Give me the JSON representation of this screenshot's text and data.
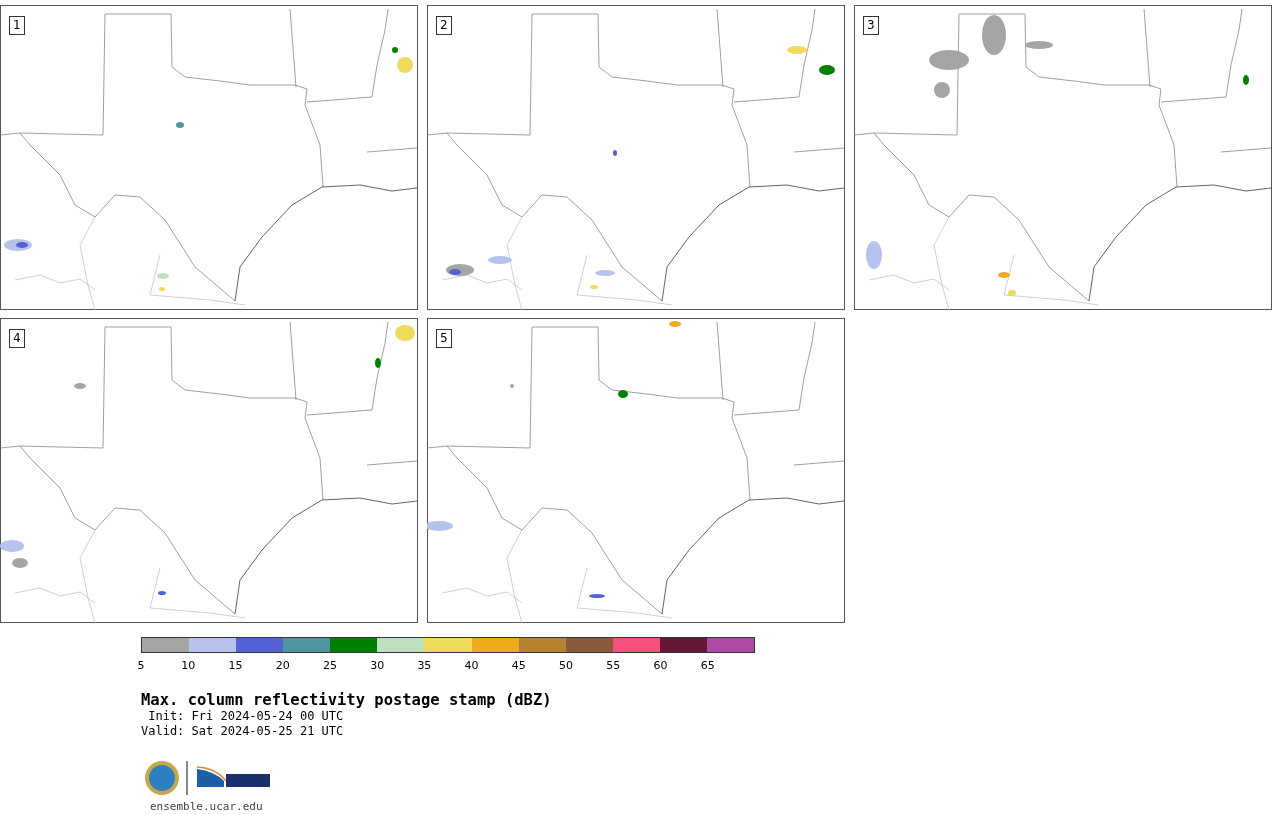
{
  "panels": [
    {
      "label": "1"
    },
    {
      "label": "2"
    },
    {
      "label": "3"
    },
    {
      "label": "4"
    },
    {
      "label": "5"
    }
  ],
  "colorbar": {
    "segments": [
      {
        "color": "#a5a5a5"
      },
      {
        "color": "#b7c3ec"
      },
      {
        "color": "#5462d6"
      },
      {
        "color": "#4f969e"
      },
      {
        "color": "#008000"
      },
      {
        "color": "#c0dfc0"
      },
      {
        "color": "#eedb5c"
      },
      {
        "color": "#eeaa1c"
      },
      {
        "color": "#b78230"
      },
      {
        "color": "#8a5a3c"
      },
      {
        "color": "#f4527c"
      },
      {
        "color": "#651836"
      },
      {
        "color": "#ac4aa4"
      }
    ],
    "ticks": [
      "5",
      "10",
      "15",
      "20",
      "25",
      "30",
      "35",
      "40",
      "45",
      "50",
      "55",
      "60",
      "65"
    ]
  },
  "title": "Max. column reflectivity postage stamp (dBZ)",
  "init": " Init: Fri 2024-05-24 00 UTC",
  "valid": "Valid: Sat 2024-05-25 21 UTC",
  "url": "ensemble.ucar.edu"
}
